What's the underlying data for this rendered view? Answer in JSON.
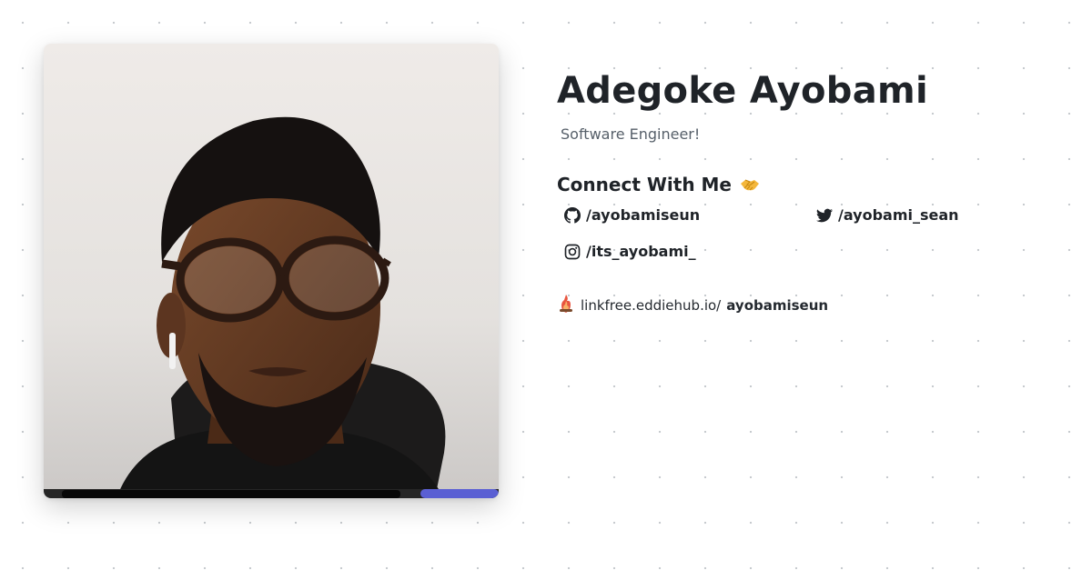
{
  "profile": {
    "name": "Adegoke Ayobami",
    "subtitle": "Software Engineer!",
    "photo_alt": "Adegoke Ayobami"
  },
  "connect": {
    "heading": "Connect With Me",
    "emoji_icon": "handshake-icon"
  },
  "socials": [
    {
      "platform": "GitHub",
      "icon": "github-icon",
      "handle": "/ayobamiseun"
    },
    {
      "platform": "Twitter",
      "icon": "twitter-icon",
      "handle": "/ayobami_sean"
    },
    {
      "platform": "Instagram",
      "icon": "instagram-icon",
      "handle": "/its_ayobami_"
    }
  ],
  "linkfree": {
    "icon": "linkfree-logo-icon",
    "prefix": "linkfree.eddiehub.io/",
    "username": "ayobamiseun"
  },
  "colors": {
    "text": "#1f2328",
    "muted": "#57606a",
    "accent_button": "#5a5fd3"
  }
}
